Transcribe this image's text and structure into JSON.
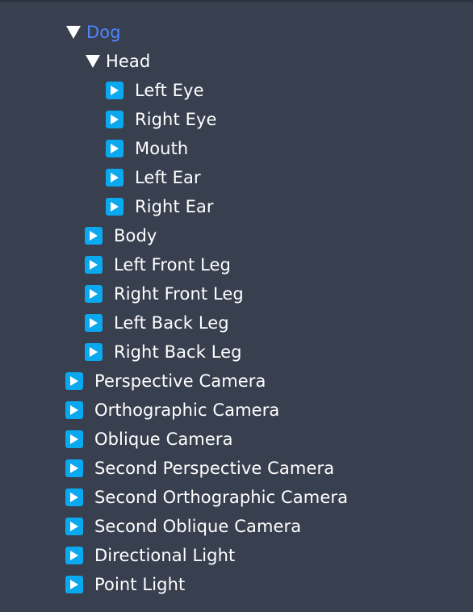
{
  "tree": {
    "nodes": [
      {
        "label": "Dog",
        "level": 0,
        "expanded": true,
        "selected": true
      },
      {
        "label": "Head",
        "level": 1,
        "expanded": true,
        "selected": false
      },
      {
        "label": "Left Eye",
        "level": 2,
        "expanded": false,
        "selected": false
      },
      {
        "label": "Right Eye",
        "level": 2,
        "expanded": false,
        "selected": false
      },
      {
        "label": "Mouth",
        "level": 2,
        "expanded": false,
        "selected": false
      },
      {
        "label": "Left Ear",
        "level": 2,
        "expanded": false,
        "selected": false
      },
      {
        "label": "Right Ear",
        "level": 2,
        "expanded": false,
        "selected": false
      },
      {
        "label": "Body",
        "level": 1,
        "expanded": false,
        "selected": false
      },
      {
        "label": "Left Front Leg",
        "level": 1,
        "expanded": false,
        "selected": false
      },
      {
        "label": "Right Front Leg",
        "level": 1,
        "expanded": false,
        "selected": false
      },
      {
        "label": "Left Back Leg",
        "level": 1,
        "expanded": false,
        "selected": false
      },
      {
        "label": "Right Back Leg",
        "level": 1,
        "expanded": false,
        "selected": false
      },
      {
        "label": "Perspective Camera",
        "level": 0,
        "expanded": false,
        "selected": false
      },
      {
        "label": "Orthographic Camera",
        "level": 0,
        "expanded": false,
        "selected": false
      },
      {
        "label": "Oblique Camera",
        "level": 0,
        "expanded": false,
        "selected": false
      },
      {
        "label": "Second Perspective Camera",
        "level": 0,
        "expanded": false,
        "selected": false
      },
      {
        "label": "Second Orthographic Camera",
        "level": 0,
        "expanded": false,
        "selected": false
      },
      {
        "label": "Second Oblique Camera",
        "level": 0,
        "expanded": false,
        "selected": false
      },
      {
        "label": "Directional Light",
        "level": 0,
        "expanded": false,
        "selected": false
      },
      {
        "label": "Point Light",
        "level": 0,
        "expanded": false,
        "selected": false
      }
    ]
  },
  "icons": {
    "expanded": "triangle-down-icon",
    "collapsed": "play-square-icon"
  },
  "colors": {
    "background": "#383f4f",
    "text": "#ffffff",
    "selected_text": "#4d86ff",
    "collapsed_icon_bg": "#0aa9ef"
  }
}
